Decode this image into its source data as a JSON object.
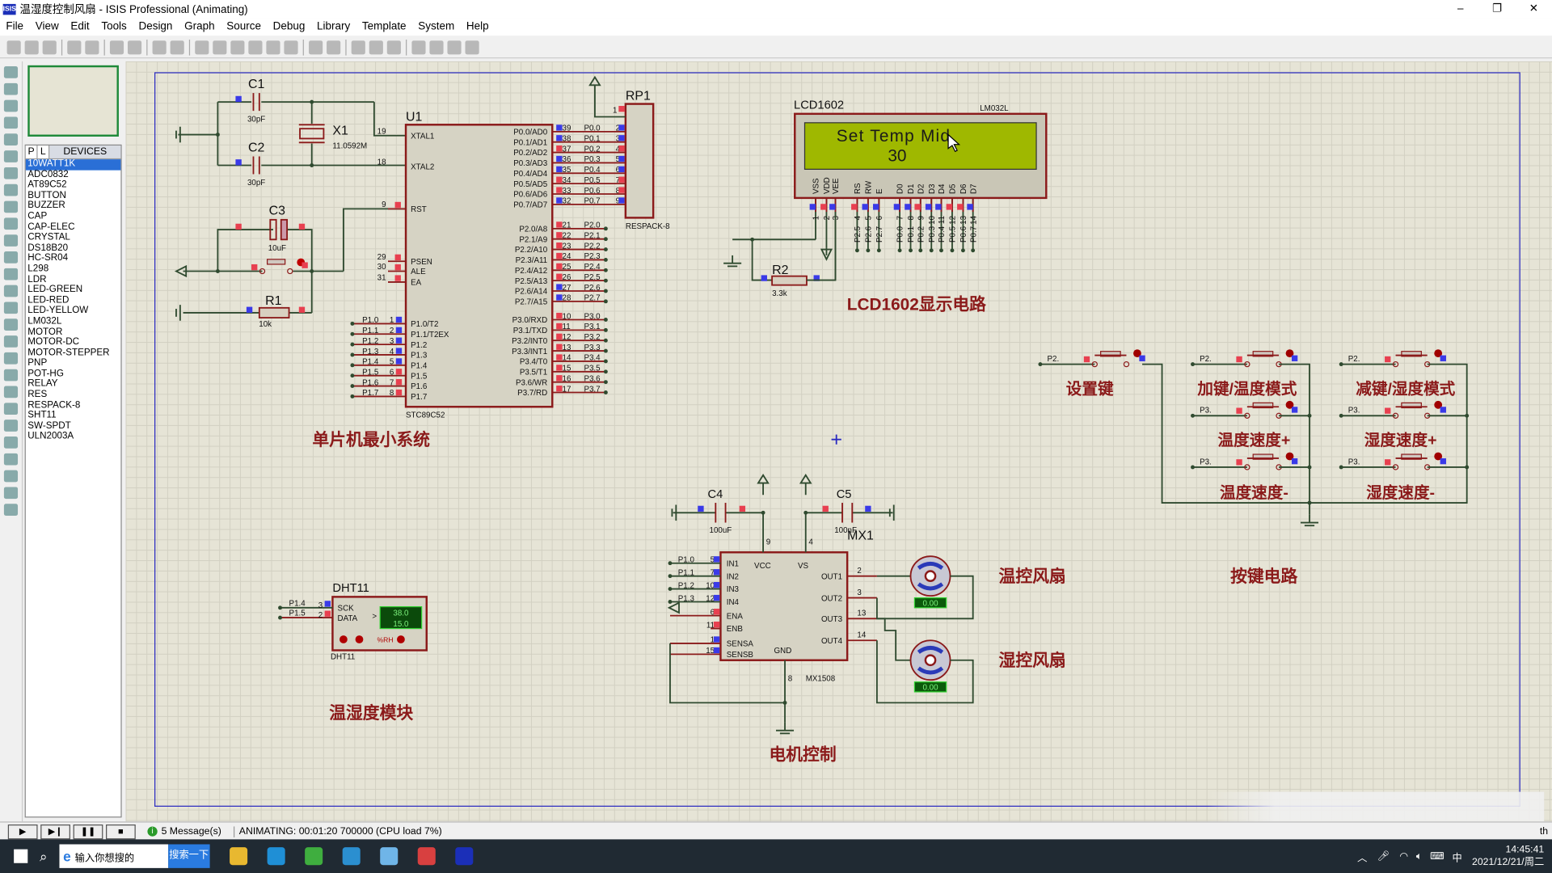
{
  "window": {
    "title": "温湿度控制风扇 - ISIS Professional (Animating)",
    "app_icon": "ISIS",
    "controls": [
      "–",
      "❐",
      "✕"
    ]
  },
  "menu": [
    "File",
    "View",
    "Edit",
    "Tools",
    "Design",
    "Graph",
    "Source",
    "Debug",
    "Library",
    "Template",
    "System",
    "Help"
  ],
  "toolbar_icons": [
    "new-file-icon",
    "open-file-icon",
    "save-icon",
    "|",
    "import-icon",
    "export-icon",
    "|",
    "print-icon",
    "print-area-icon",
    "|",
    "refresh-icon",
    "grid-icon",
    "|",
    "origin-icon",
    "pan-icon",
    "zoom-in-icon",
    "zoom-out-icon",
    "zoom-all-icon",
    "zoom-area-icon",
    "|",
    "undo-icon",
    "redo-icon",
    "|",
    "cut-icon",
    "copy-icon",
    "paste-icon",
    "|",
    "block-copy-icon",
    "block-move-icon",
    "block-rotate-icon",
    "block-delete-icon"
  ],
  "left_tools": [
    "selection-icon",
    "component-icon",
    "junction-icon",
    "wire-label-icon",
    "text-script-icon",
    "bus-icon",
    "subcircuit-icon",
    "terminal-icon",
    "pin-icon",
    "graph-icon",
    "tape-icon",
    "generator-icon",
    "voltage-probe-icon",
    "current-probe-icon",
    "instrument-icon",
    "line-icon",
    "box-icon",
    "circle-icon",
    "arc-icon",
    "path-icon",
    "text-icon",
    "symbol-icon",
    "marker-icon",
    "rotate-cw-icon",
    "rotate-ccw-icon",
    "mirror-x-icon",
    "mirror-y-icon"
  ],
  "devices": {
    "tabs": [
      "P",
      "L"
    ],
    "title": "DEVICES",
    "selected": 0,
    "items": [
      "10WATT1K",
      "ADC0832",
      "AT89C52",
      "BUTTON",
      "BUZZER",
      "CAP",
      "CAP-ELEC",
      "CRYSTAL",
      "DS18B20",
      "HC-SR04",
      "L298",
      "LDR",
      "LED-GREEN",
      "LED-RED",
      "LED-YELLOW",
      "LM032L",
      "MOTOR",
      "MOTOR-DC",
      "MOTOR-STEPPER",
      "PNP",
      "POT-HG",
      "RELAY",
      "RES",
      "RESPACK-8",
      "SHT11",
      "SW-SPDT",
      "ULN2003A"
    ]
  },
  "rotation_value": "0",
  "schematic": {
    "sections": {
      "mcu": "单片机最小系统",
      "lcd": "LCD1602显示电路",
      "keys": "按键电路",
      "sensor": "温湿度模块",
      "motor": "电机控制",
      "fan1": "温控风扇",
      "fan2": "湿控风扇"
    },
    "c1": {
      "ref": "C1",
      "value": "30pF"
    },
    "c2": {
      "ref": "C2",
      "value": "30pF"
    },
    "x1": {
      "ref": "X1",
      "value": "11.0592M"
    },
    "c3": {
      "ref": "C3",
      "value": "10uF"
    },
    "r1": {
      "ref": "R1",
      "value": "10k"
    },
    "r2": {
      "ref": "R2",
      "value": "3.3k"
    },
    "u1": {
      "ref": "U1",
      "part": "STC89C52",
      "left": [
        {
          "n": "19",
          "name": "XTAL1"
        },
        {
          "n": "18",
          "name": "XTAL2"
        },
        {
          "n": "9",
          "name": "RST"
        },
        {
          "n": "29",
          "name": "PSEN"
        },
        {
          "n": "30",
          "name": "ALE"
        },
        {
          "n": "31",
          "name": "EA"
        }
      ],
      "p1": [
        {
          "n": "1",
          "name": "P1.0/T2",
          "net": "P1.0",
          "s": "b"
        },
        {
          "n": "2",
          "name": "P1.1/T2EX",
          "net": "P1.1",
          "s": "b"
        },
        {
          "n": "3",
          "name": "P1.2",
          "net": "P1.2",
          "s": "b"
        },
        {
          "n": "4",
          "name": "P1.3",
          "net": "P1.3",
          "s": "b"
        },
        {
          "n": "5",
          "name": "P1.4",
          "net": "P1.4",
          "s": "b"
        },
        {
          "n": "6",
          "name": "P1.5",
          "net": "P1.5",
          "s": "r"
        },
        {
          "n": "7",
          "name": "P1.6",
          "net": "P1.6",
          "s": "r"
        },
        {
          "n": "8",
          "name": "P1.7",
          "net": "P1.7",
          "s": "r"
        }
      ],
      "p0": [
        {
          "n": "39",
          "name": "P0.0/AD0",
          "net": "P0.0",
          "rp": "2",
          "s": "b"
        },
        {
          "n": "38",
          "name": "P0.1/AD1",
          "net": "P0.1",
          "rp": "3",
          "s": "b"
        },
        {
          "n": "37",
          "name": "P0.2/AD2",
          "net": "P0.2",
          "rp": "4",
          "s": "r"
        },
        {
          "n": "36",
          "name": "P0.3/AD3",
          "net": "P0.3",
          "rp": "5",
          "s": "b"
        },
        {
          "n": "35",
          "name": "P0.4/AD4",
          "net": "P0.4",
          "rp": "6",
          "s": "b"
        },
        {
          "n": "34",
          "name": "P0.5/AD5",
          "net": "P0.5",
          "rp": "7",
          "s": "r"
        },
        {
          "n": "33",
          "name": "P0.6/AD6",
          "net": "P0.6",
          "rp": "8",
          "s": "r"
        },
        {
          "n": "32",
          "name": "P0.7/AD7",
          "net": "P0.7",
          "rp": "9",
          "s": "b"
        }
      ],
      "p2": [
        {
          "n": "21",
          "name": "P2.0/A8",
          "net": "P2.0",
          "s": "r"
        },
        {
          "n": "22",
          "name": "P2.1/A9",
          "net": "P2.1",
          "s": "r"
        },
        {
          "n": "23",
          "name": "P2.2/A10",
          "net": "P2.2",
          "s": "r"
        },
        {
          "n": "24",
          "name": "P2.3/A11",
          "net": "P2.3",
          "s": "r"
        },
        {
          "n": "25",
          "name": "P2.4/A12",
          "net": "P2.4",
          "s": "r"
        },
        {
          "n": "26",
          "name": "P2.5/A13",
          "net": "P2.5",
          "s": "r"
        },
        {
          "n": "27",
          "name": "P2.6/A14",
          "net": "P2.6",
          "s": "b"
        },
        {
          "n": "28",
          "name": "P2.7/A15",
          "net": "P2.7",
          "s": "b"
        }
      ],
      "p3": [
        {
          "n": "10",
          "name": "P3.0/RXD",
          "net": "P3.0",
          "s": "r"
        },
        {
          "n": "11",
          "name": "P3.1/TXD",
          "net": "P3.1",
          "s": "r"
        },
        {
          "n": "12",
          "name": "P3.2/INT0",
          "net": "P3.2",
          "s": "r"
        },
        {
          "n": "13",
          "name": "P3.3/INT1",
          "net": "P3.3",
          "s": "r"
        },
        {
          "n": "14",
          "name": "P3.4/T0",
          "net": "P3.4",
          "s": "r"
        },
        {
          "n": "15",
          "name": "P3.5/T1",
          "net": "P3.5",
          "s": "r"
        },
        {
          "n": "16",
          "name": "P3.6/WR",
          "net": "P3.6",
          "s": "r"
        },
        {
          "n": "17",
          "name": "P3.7/RD",
          "net": "P3.7",
          "s": "r"
        }
      ]
    },
    "rp1": {
      "ref": "RP1",
      "part": "RESPACK-8",
      "pin1": "1"
    },
    "lcd": {
      "ref": "LCD1602",
      "part": "LM032L",
      "line1": "Set Temp Mid",
      "line2": "30",
      "pins": [
        {
          "n": "1",
          "name": "VSS",
          "net": "",
          "s": "b"
        },
        {
          "n": "2",
          "name": "VDD",
          "net": "",
          "s": "r"
        },
        {
          "n": "3",
          "name": "VEE",
          "net": "",
          "s": "b"
        },
        {
          "n": "4",
          "name": "RS",
          "net": "P2.5",
          "s": "r"
        },
        {
          "n": "5",
          "name": "RW",
          "net": "P2.6",
          "s": "b"
        },
        {
          "n": "6",
          "name": "E",
          "net": "P2.7",
          "s": "b"
        },
        {
          "n": "7",
          "name": "D0",
          "net": "P0.0",
          "s": "b"
        },
        {
          "n": "8",
          "name": "D1",
          "net": "P0.1",
          "s": "b"
        },
        {
          "n": "9",
          "name": "D2",
          "net": "P0.2",
          "s": "r"
        },
        {
          "n": "10",
          "name": "D3",
          "net": "P0.3",
          "s": "b"
        },
        {
          "n": "11",
          "name": "D4",
          "net": "P0.4",
          "s": "b"
        },
        {
          "n": "12",
          "name": "D5",
          "net": "P0.5",
          "s": "r"
        },
        {
          "n": "13",
          "name": "D6",
          "net": "P0.6",
          "s": "r"
        },
        {
          "n": "14",
          "name": "D7",
          "net": "P0.7",
          "s": "b"
        }
      ]
    },
    "keys": [
      {
        "net": "P2.",
        "label": "设置键"
      },
      {
        "net": "P2.",
        "label": "加键/温度模式"
      },
      {
        "net": "P2.",
        "label": "减键/湿度模式"
      },
      {
        "net": "P3.",
        "label": "温度速度+"
      },
      {
        "net": "P3.",
        "label": "湿度速度+"
      },
      {
        "net": "P3.",
        "label": "温度速度-"
      },
      {
        "net": "P3.",
        "label": "湿度速度-"
      }
    ],
    "dht11": {
      "ref": "DHT11",
      "part": "DHT11",
      "pins": [
        {
          "n": "3",
          "name": "SCK",
          "net": "P1.4"
        },
        {
          "n": "2",
          "name": "DATA",
          "net": "P1.5"
        }
      ],
      "temp": "38.0",
      "hum": "15.0",
      "arrow": ">",
      "unit": "%RH"
    },
    "mx1": {
      "ref": "MX1",
      "part": "MX1508",
      "c4": {
        "ref": "C4",
        "value": "100uF"
      },
      "c5": {
        "ref": "C5",
        "value": "100nF"
      },
      "vcc_pin": "9",
      "vs_pin": "4",
      "gnd_pin": "8",
      "vcc": "VCC",
      "vs": "VS",
      "gnd": "GND",
      "inputs": [
        {
          "n": "5",
          "name": "IN1",
          "net": "P1.0"
        },
        {
          "n": "7",
          "name": "IN2",
          "net": "P1.1"
        },
        {
          "n": "10",
          "name": "IN3",
          "net": "P1.2"
        },
        {
          "n": "12",
          "name": "IN4",
          "net": "P1.3"
        },
        {
          "n": "6",
          "name": "ENA",
          "net": ""
        },
        {
          "n": "11",
          "name": "ENB",
          "net": ""
        },
        {
          "n": "1",
          "name": "SENSA",
          "net": ""
        },
        {
          "n": "15",
          "name": "SENSB",
          "net": ""
        }
      ],
      "outputs": [
        {
          "n": "2",
          "name": "OUT1"
        },
        {
          "n": "3",
          "name": "OUT2"
        },
        {
          "n": "13",
          "name": "OUT3"
        },
        {
          "n": "14",
          "name": "OUT4"
        }
      ],
      "motor1_speed": "0.00",
      "motor2_speed": "0.00"
    }
  },
  "status": {
    "buttons": [
      "▶",
      "▶❙",
      "❚❚",
      "■"
    ],
    "messages": "5 Message(s)",
    "animating": "ANIMATING: 00:01:20 700000 (CPU load 7%)",
    "corner": "th"
  },
  "taskbar": {
    "search_placeholder": "输入你想搜的",
    "search_button": "搜索一下",
    "apps": [
      "file-explorer-icon",
      "edge-icon",
      "browser-360-icon",
      "media-player-icon",
      "qq-icon",
      "video-icon",
      "isis-icon"
    ],
    "ime": "中",
    "time": "14:45:41",
    "date": "2021/12/21/周二"
  }
}
